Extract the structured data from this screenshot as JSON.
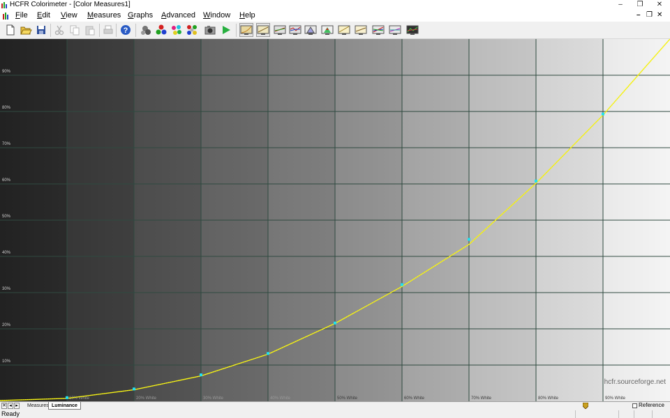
{
  "window": {
    "title": "HCFR Colorimeter - [Color Measures1]",
    "controls": {
      "minimize": "–",
      "restore": "❐",
      "close": "✕"
    }
  },
  "menu": {
    "items": [
      "File",
      "Edit",
      "View",
      "Measures",
      "Graphs",
      "Advanced",
      "Window",
      "Help"
    ],
    "mdi_controls": {
      "minimize": "–",
      "restore": "❐",
      "close": "✕"
    }
  },
  "toolbar": {
    "buttons": [
      {
        "name": "new-icon"
      },
      {
        "name": "open-folder-icon"
      },
      {
        "name": "save-icon"
      },
      {
        "name": "cut-icon"
      },
      {
        "name": "copy-icon"
      },
      {
        "name": "paste-icon"
      },
      {
        "name": "print-icon"
      },
      {
        "name": "help-icon"
      },
      {
        "name": "sensor-icon"
      },
      {
        "name": "rgb-icon"
      },
      {
        "name": "color-balls-icon"
      },
      {
        "name": "color-grid-icon"
      },
      {
        "name": "camera-icon"
      },
      {
        "name": "play-icon"
      },
      {
        "name": "luminance-graph-icon"
      },
      {
        "name": "gamma-graph-icon"
      },
      {
        "name": "rgb-levels-graph-icon"
      },
      {
        "name": "color-temperature-graph-icon"
      },
      {
        "name": "cie-graph-icon"
      },
      {
        "name": "near-black-graph-icon"
      },
      {
        "name": "near-white-graph-icon"
      },
      {
        "name": "saturation-luminance-graph-icon"
      },
      {
        "name": "saturation-shift-graph-icon"
      },
      {
        "name": "measures-comparison-graph-icon"
      }
    ]
  },
  "chart_data": {
    "type": "line",
    "x_tick_labels": [
      "10% White",
      "20% White",
      "30% White",
      "40% White",
      "50% White",
      "60% White",
      "70% White",
      "80% White",
      "90% White"
    ],
    "y_tick_labels": [
      "10%",
      "20%",
      "30%",
      "40%",
      "50%",
      "60%",
      "70%",
      "80%",
      "90%"
    ],
    "xlim": [
      0,
      100
    ],
    "ylim": [
      0,
      100
    ],
    "grid": true,
    "background": "grayscale-ramp",
    "series": [
      {
        "color": "#f4f000",
        "x": [
          0,
          10,
          20,
          30,
          40,
          50,
          60,
          70,
          80,
          90,
          100
        ],
        "values": [
          0.2,
          0.8,
          3.2,
          7.0,
          13.0,
          21.5,
          31.7,
          43.3,
          60.2,
          79.0,
          100
        ]
      }
    ],
    "markers": {
      "color": "#22e0f0",
      "x": [
        10,
        20,
        30,
        40,
        50,
        60,
        70,
        80,
        90
      ],
      "values": [
        1.0,
        3.4,
        7.3,
        13.2,
        21.6,
        32.2,
        44.7,
        60.8,
        79.3
      ]
    },
    "watermark": "hcfr.sourceforge.net"
  },
  "tabs": {
    "items": [
      "Measures",
      "Luminance"
    ],
    "active": "Luminance",
    "reference_label": "Reference"
  },
  "status": {
    "text": "Ready"
  }
}
